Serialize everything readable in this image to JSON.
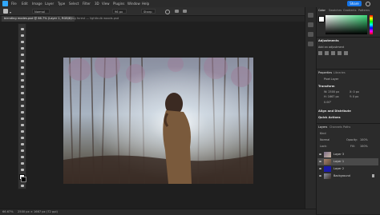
{
  "menubar": {
    "items": [
      "File",
      "Edit",
      "Image",
      "Layer",
      "Type",
      "Select",
      "Filter",
      "3D",
      "View",
      "Plugins",
      "Window",
      "Help"
    ],
    "share_label": "Share"
  },
  "options": {
    "mode": "Normal",
    "size": "96 px",
    "color": "Sharp"
  },
  "tabs": [
    {
      "label": "blending modes.psd @ 66.7% (Layer 1, RGB/8)",
      "active": true
    },
    {
      "label": "fog forest — lightbulb woods.psd",
      "active": false
    }
  ],
  "status": {
    "zoom": "66.67%",
    "info": "2500 px × 1667 px (72 ppi)"
  },
  "right_panel": {
    "color_tabs": [
      "Color",
      "Swatches",
      "Gradients",
      "Patterns"
    ],
    "adjustments": {
      "title": "Adjustments",
      "hint": "Add an adjustment"
    },
    "properties": {
      "tabs": [
        "Properties",
        "Libraries"
      ],
      "layer_kind": "Pixel Layer",
      "section_transform": "Transform",
      "w": "W: 2500 px",
      "h": "H: 1667 px",
      "x": "X: 0 px",
      "y": "Y: 0 px",
      "angle": "0.00°",
      "section_align": "Align and Distribute",
      "section_quick": "Quick Actions"
    },
    "layers": {
      "tabs": [
        "Layers",
        "Channels",
        "Paths"
      ],
      "kind": "Kind",
      "blend": "Normal",
      "opacity_label": "Opacity:",
      "opacity": "100%",
      "lock_label": "Lock:",
      "fill_label": "Fill:",
      "fill": "100%",
      "items": [
        {
          "name": "Layer 3",
          "selected": false
        },
        {
          "name": "Layer 1",
          "selected": true
        },
        {
          "name": "Layer 2",
          "selected": false
        },
        {
          "name": "Background",
          "selected": false
        }
      ]
    }
  },
  "annotation": {
    "badge": "1"
  },
  "colors": {
    "accent": "#1473e6",
    "badge": "#d8272c",
    "layer2_thumb": "#1b1ba8"
  }
}
